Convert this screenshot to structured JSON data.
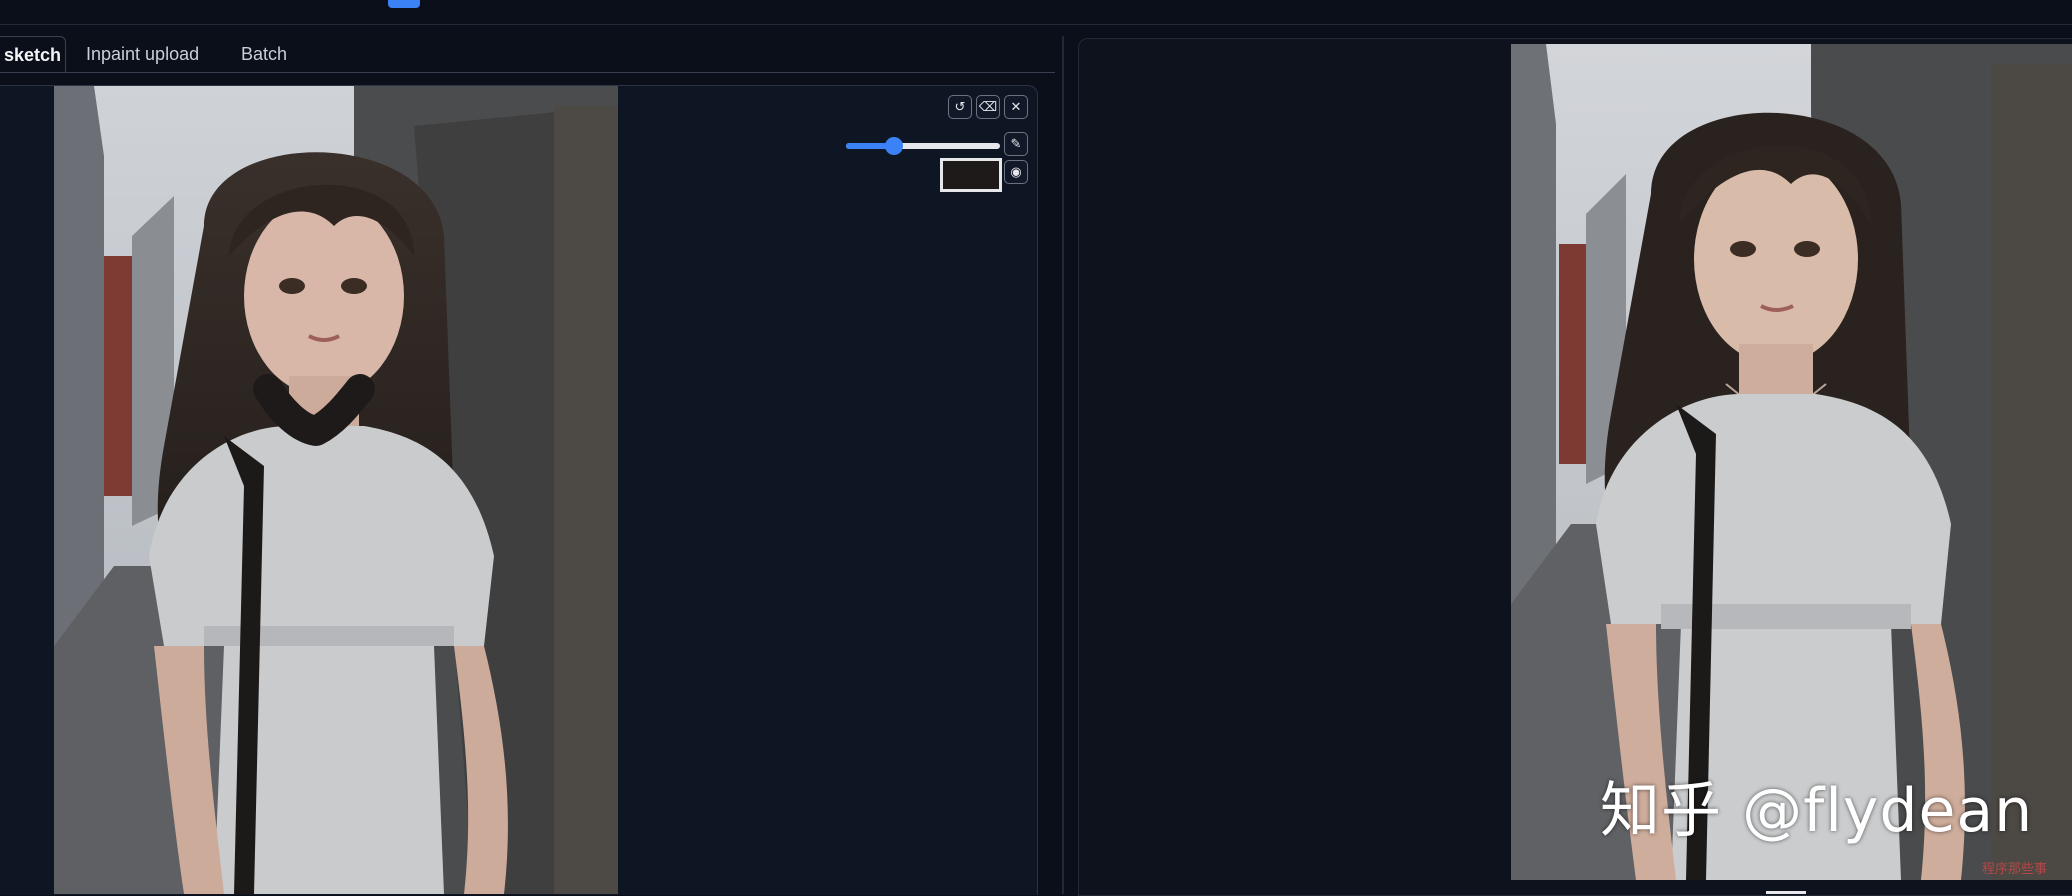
{
  "tabs": [
    {
      "label": "sketch",
      "active": true
    },
    {
      "label": "Inpaint upload",
      "active": false
    },
    {
      "label": "Batch",
      "active": false
    }
  ],
  "canvas_tools": {
    "undo_icon": "undo-icon",
    "eraser_icon": "eraser-icon",
    "close_icon": "close-icon",
    "brush_icon": "brush-icon",
    "palette_icon": "palette-icon",
    "brush_size_fraction": 0.31,
    "brush_color": "#1f1a1a"
  },
  "colors": {
    "accent": "#3b82f6",
    "background": "#0b0f19"
  },
  "result": {
    "watermark": "知乎 @flydean",
    "small_mark": "程序那些事"
  }
}
